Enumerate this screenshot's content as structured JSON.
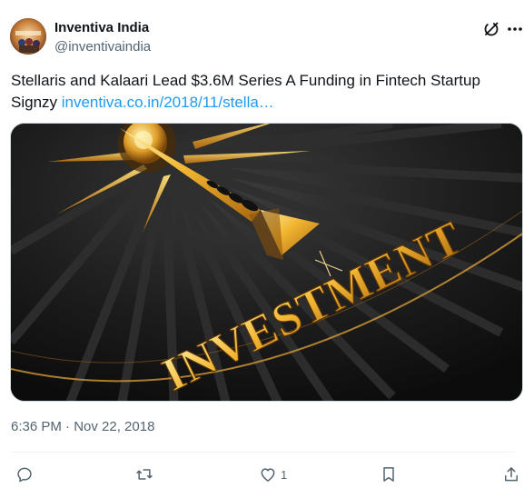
{
  "author": {
    "name": "Inventiva India",
    "handle": "@inventivaindia",
    "avatar_icon": "inventiva-logo-avatar"
  },
  "tweet": {
    "text": "Stellaris and Kalaari Lead $3.6M Series A Funding in Fintech Startup Signzy ",
    "link": "inventiva.co.in/2018/11/stella…",
    "timestamp": "6:36 PM · Nov 22, 2018"
  },
  "media": {
    "description_icon": "golden-compass-investment-image",
    "word": "INVESTMENT"
  },
  "actions": {
    "reply_count": "",
    "retweet_count": "",
    "like_count": "1",
    "bookmark_count": ""
  },
  "colors": {
    "link": "#1d9bf0",
    "secondary_text": "#536471",
    "gold": "#e8a21e"
  }
}
